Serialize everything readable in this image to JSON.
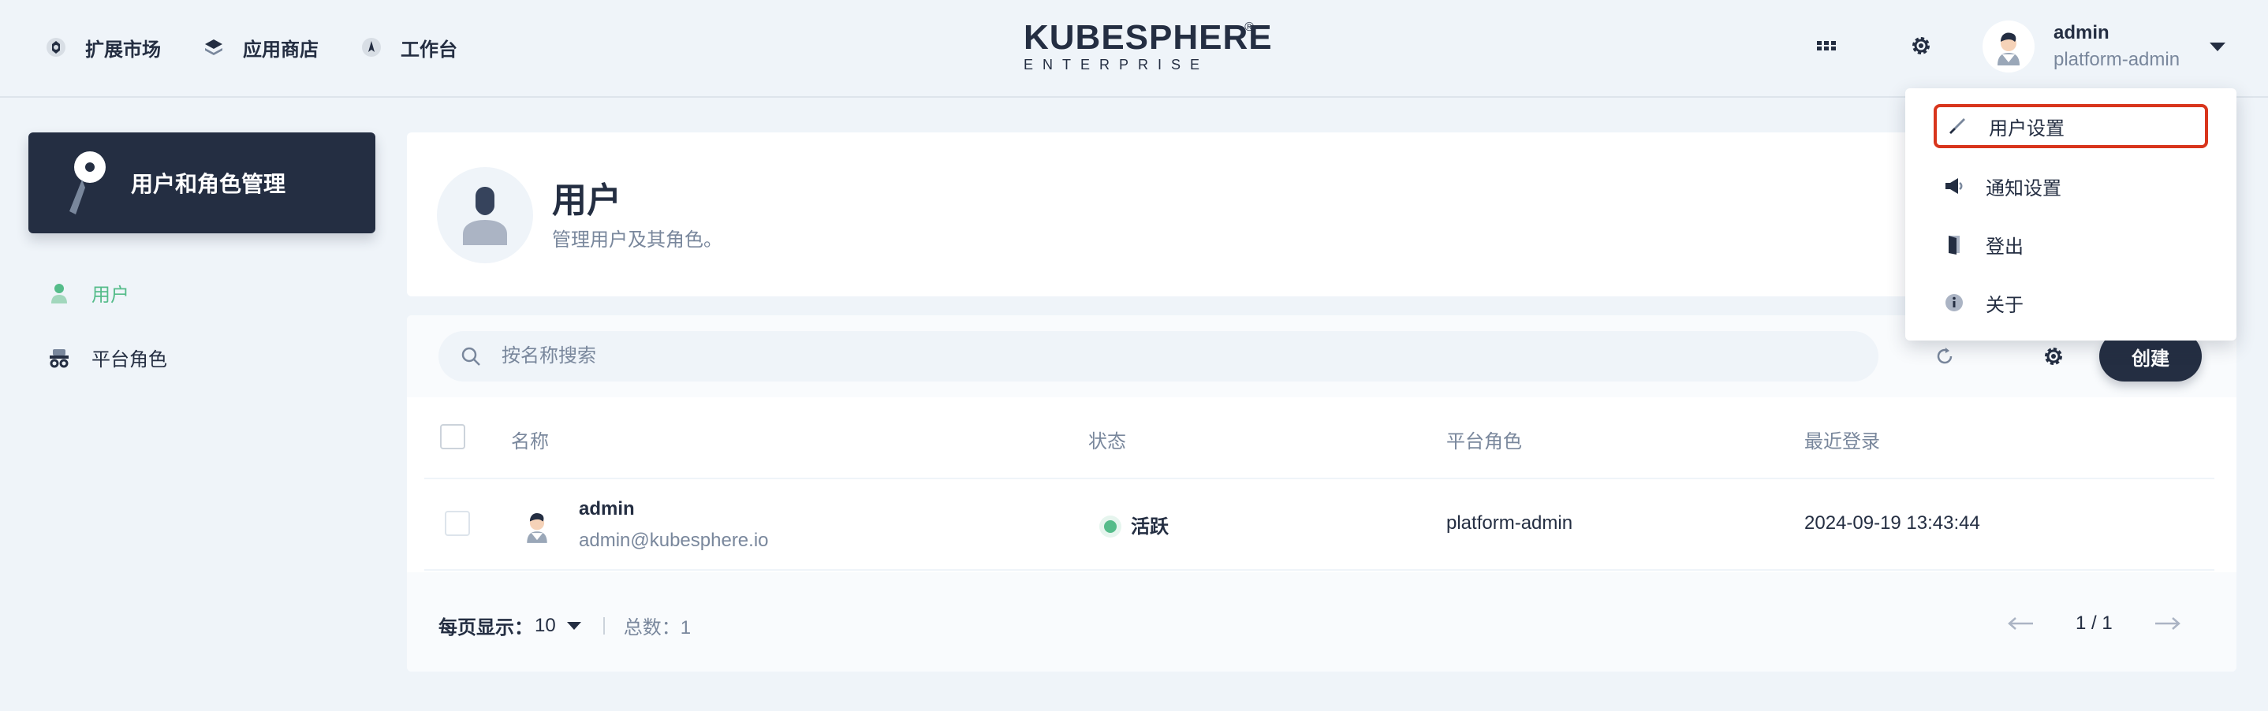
{
  "header": {
    "nav": [
      {
        "label": "扩展市场",
        "icon": "extension-icon"
      },
      {
        "label": "应用商店",
        "icon": "layers-icon"
      },
      {
        "label": "工作台",
        "icon": "workbench-icon"
      }
    ],
    "logo": {
      "word": "KUBESPHERE",
      "sub": "ENTERPRISE",
      "reg": "®"
    },
    "user": {
      "name": "admin",
      "role": "platform-admin"
    }
  },
  "sidebar": {
    "title": "用户和角色管理",
    "items": [
      {
        "label": "用户",
        "active": true
      },
      {
        "label": "平台角色",
        "active": false
      }
    ]
  },
  "banner": {
    "title": "用户",
    "desc": "管理用户及其角色。"
  },
  "table": {
    "search_placeholder": "按名称搜索",
    "create_label": "创建",
    "columns": [
      "名称",
      "状态",
      "平台角色",
      "最近登录"
    ],
    "rows": [
      {
        "name": "admin",
        "email": "admin@kubesphere.io",
        "status": "活跃",
        "role": "platform-admin",
        "last_login": "2024-09-19 13:43:44"
      }
    ]
  },
  "pagination": {
    "per_page_label": "每页显示：",
    "per_page": "10",
    "total_label": "总数：1",
    "page": "1 / 1"
  },
  "user_menu": {
    "items": [
      {
        "label": "用户设置",
        "highlighted": true
      },
      {
        "label": "通知设置"
      },
      {
        "label": "登出"
      },
      {
        "label": "关于"
      }
    ]
  },
  "colors": {
    "accent": "#55bc8a",
    "dark": "#242e42",
    "highlight": "#d8351c",
    "bg": "#eff4f9"
  }
}
